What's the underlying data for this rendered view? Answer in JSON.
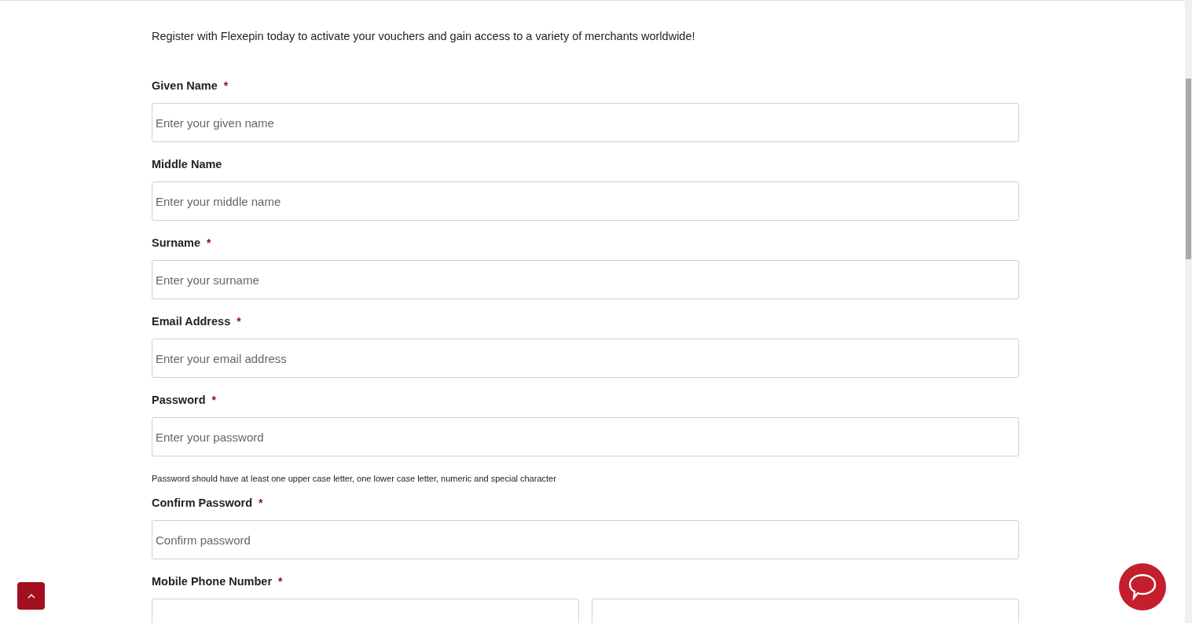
{
  "intro": "Register with Flexepin today to activate your vouchers and gain access to a variety of merchants worldwide!",
  "fields": [
    {
      "kind": "text",
      "label": "Given Name",
      "required": true,
      "placeholder": "Enter your given name"
    },
    {
      "kind": "text",
      "label": "Middle Name",
      "required": false,
      "placeholder": "Enter your middle name"
    },
    {
      "kind": "text",
      "label": "Surname",
      "required": true,
      "placeholder": "Enter your surname"
    },
    {
      "kind": "text",
      "label": "Email Address",
      "required": true,
      "placeholder": "Enter your email address"
    },
    {
      "kind": "text",
      "label": "Password",
      "required": true,
      "placeholder": "Enter your password",
      "hint": "Password should have at least one upper case letter, one lower case letter, numeric and special character"
    },
    {
      "kind": "text",
      "label": "Confirm Password",
      "required": true,
      "placeholder": "Confirm password"
    },
    {
      "kind": "phone",
      "label": "Mobile Phone Number",
      "required": true
    }
  ],
  "required_mark": "*"
}
